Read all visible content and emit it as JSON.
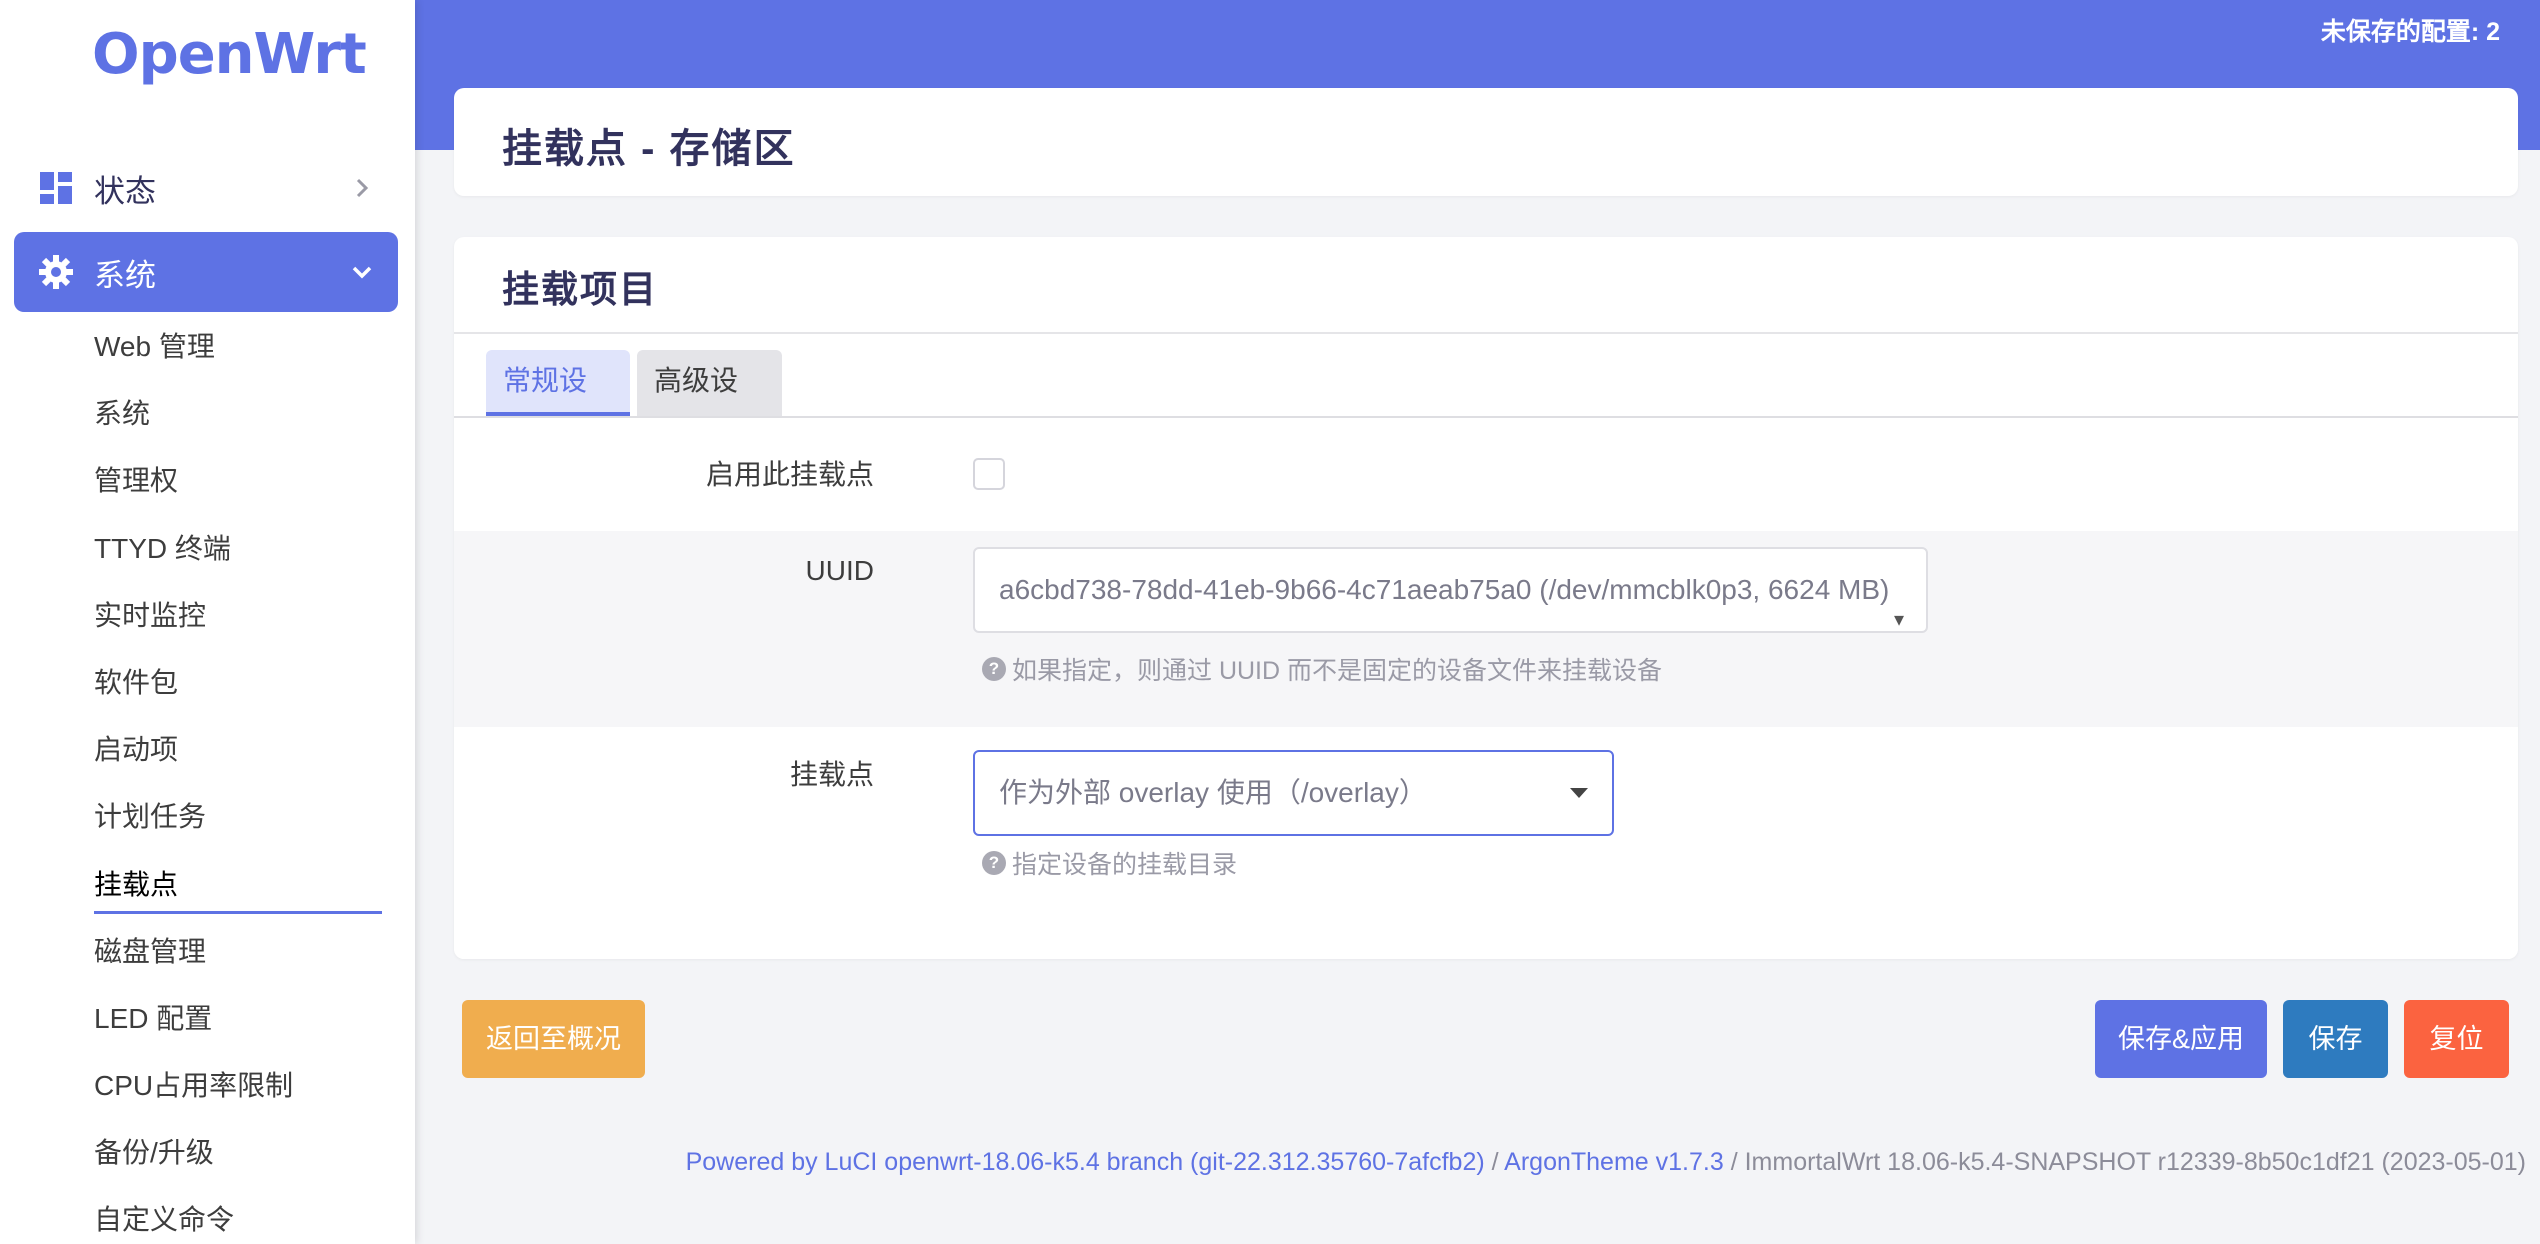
{
  "app": {
    "logo_text": "OpenWrt"
  },
  "header": {
    "unsaved_text": "未保存的配置: 2"
  },
  "sidebar": {
    "top_items": [
      {
        "label": "状态",
        "icon": "dashboard-icon",
        "expanded": false
      },
      {
        "label": "系统",
        "icon": "gear-icon",
        "expanded": true
      }
    ],
    "sub_items": [
      {
        "label": "Web 管理"
      },
      {
        "label": "系统"
      },
      {
        "label": "管理权"
      },
      {
        "label": "TTYD 终端"
      },
      {
        "label": "实时监控"
      },
      {
        "label": "软件包"
      },
      {
        "label": "启动项"
      },
      {
        "label": "计划任务"
      },
      {
        "label": "挂载点",
        "active": true
      },
      {
        "label": "磁盘管理"
      },
      {
        "label": "LED 配置"
      },
      {
        "label": "CPU占用率限制"
      },
      {
        "label": "备份/升级"
      },
      {
        "label": "自定义命令"
      }
    ]
  },
  "page": {
    "title": "挂载点 - 存储区",
    "section_title": "挂载项目",
    "tabs": [
      {
        "label": "常规设置",
        "active": true
      },
      {
        "label": "高级设置",
        "active": false
      }
    ],
    "fields": {
      "enable": {
        "label": "启用此挂载点",
        "checked": false
      },
      "uuid": {
        "label": "UUID",
        "value": "a6cbd738-78dd-41eb-9b66-4c71aeab75a0 (/dev/mmcblk0p3, 6624 MB)",
        "hint": "如果指定，则通过 UUID 而不是固定的设备文件来挂载设备"
      },
      "mount": {
        "label": "挂载点",
        "value": "作为外部 overlay 使用（/overlay）",
        "hint": "指定设备的挂载目录"
      }
    }
  },
  "buttons": {
    "back": "返回至概况",
    "save_apply": "保存&应用",
    "save": "保存",
    "reset": "复位"
  },
  "footer": {
    "luci_link": "Powered by LuCI openwrt-18.06-k5.4 branch (git-22.312.35760-7afcfb2)",
    "sep1": " / ",
    "theme_link": "ArgonTheme v1.7.3",
    "sep2": " / ",
    "version": "ImmortalWrt 18.06-k5.4-SNAPSHOT r12339-8b50c1df21 (2023-05-01)"
  },
  "colors": {
    "primary": "#5e72e4",
    "warning": "#f0ad4e",
    "save": "#2e7bbf",
    "danger": "#fb6340"
  }
}
